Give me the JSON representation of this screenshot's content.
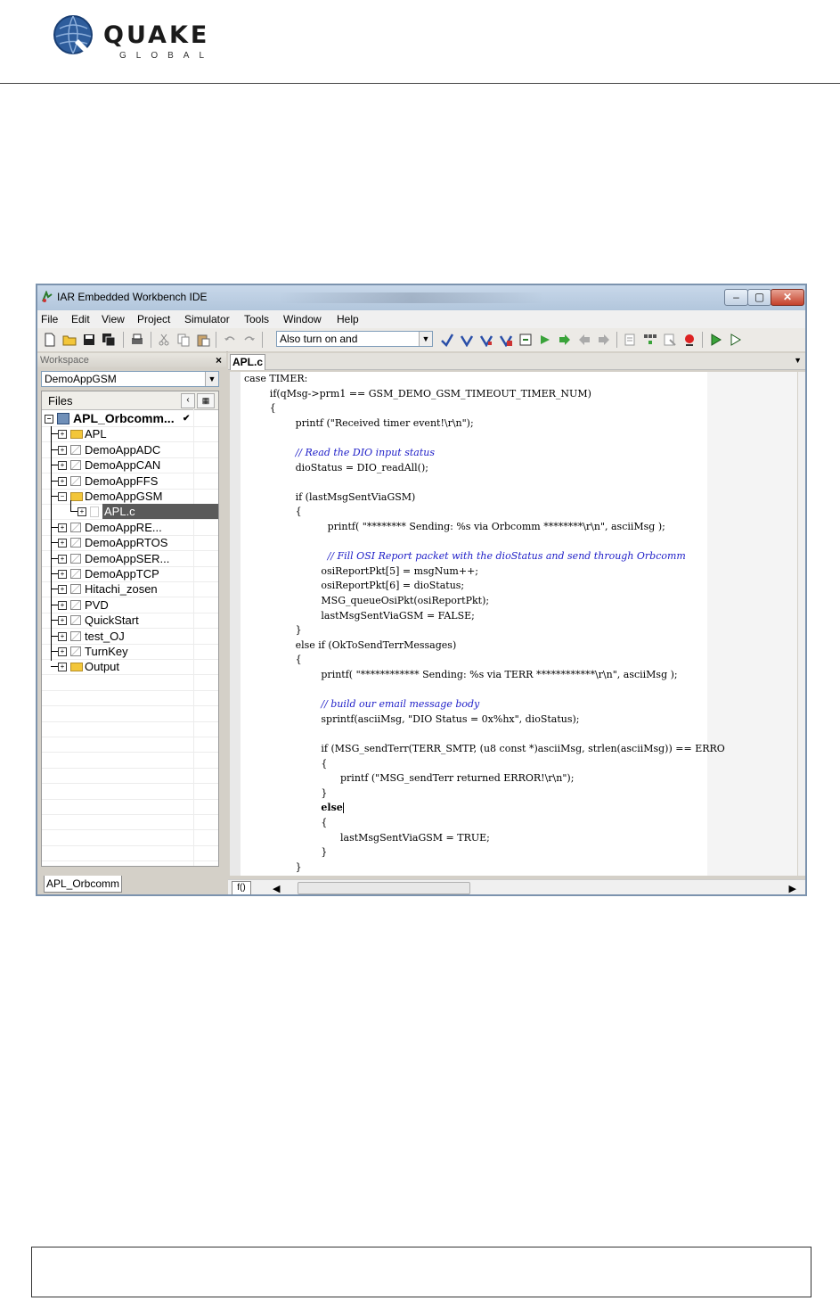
{
  "document": {
    "logo": {
      "word": "QUAKE",
      "sub": "GLOBAL"
    }
  },
  "ide": {
    "title": "IAR Embedded Workbench IDE",
    "window_buttons": {
      "minimize": "–",
      "maximize": "▢",
      "close": "✕"
    },
    "menu": [
      "File",
      "Edit",
      "View",
      "Project",
      "Simulator",
      "Tools",
      "Window",
      "Help"
    ],
    "toolbar": {
      "search_value": "Also turn on and",
      "icons": [
        "new-file-icon",
        "open-folder-icon",
        "save-icon",
        "save-all-icon",
        "print-icon",
        "cut-icon",
        "copy-icon",
        "paste-icon",
        "undo-icon",
        "redo-icon",
        "find-icon",
        "find-next-icon",
        "find-prev-icon",
        "replace-icon",
        "go-to-icon",
        "bookmark-icon",
        "next-bookmark-icon",
        "prev-bookmark-icon",
        "next-error-icon",
        "compile-icon",
        "make-icon",
        "rebuild-icon",
        "stop-build-icon",
        "breakpoint-icon",
        "debug-icon",
        "debug-no-download-icon"
      ]
    },
    "workspace": {
      "header": "Workspace",
      "close": "×",
      "config": "DemoAppGSM",
      "files_header": "Files",
      "tab": "APL_Orbcomm",
      "tree": [
        {
          "label": "APL_Orbcomm...",
          "level": 0,
          "icon": "project",
          "check": "✔"
        },
        {
          "label": "APL",
          "level": 1,
          "icon": "folder"
        },
        {
          "label": "DemoAppADC",
          "level": 1,
          "icon": "pkg"
        },
        {
          "label": "DemoAppCAN",
          "level": 1,
          "icon": "pkg"
        },
        {
          "label": "DemoAppFFS",
          "level": 1,
          "icon": "pkg"
        },
        {
          "label": "DemoAppGSM",
          "level": 1,
          "icon": "folder",
          "expanded": true
        },
        {
          "label": "APL.c",
          "level": 2,
          "icon": "file",
          "selected": true
        },
        {
          "label": "DemoAppRE...",
          "level": 1,
          "icon": "pkg"
        },
        {
          "label": "DemoAppRTOS",
          "level": 1,
          "icon": "pkg"
        },
        {
          "label": "DemoAppSER...",
          "level": 1,
          "icon": "pkg"
        },
        {
          "label": "DemoAppTCP",
          "level": 1,
          "icon": "pkg"
        },
        {
          "label": "Hitachi_zosen",
          "level": 1,
          "icon": "pkg"
        },
        {
          "label": "PVD",
          "level": 1,
          "icon": "pkg"
        },
        {
          "label": "QuickStart",
          "level": 1,
          "icon": "pkg"
        },
        {
          "label": "test_OJ",
          "level": 1,
          "icon": "pkg"
        },
        {
          "label": "TurnKey",
          "level": 1,
          "icon": "pkg"
        },
        {
          "label": "Output",
          "level": 1,
          "icon": "folder"
        }
      ]
    },
    "editor": {
      "tab": "APL.c",
      "func_button": "f()",
      "lines": [
        {
          "indent": 0,
          "text": "case TIMER:",
          "style": "code"
        },
        {
          "indent": 4,
          "text": "if(qMsg->prm1 == GSM_DEMO_GSM_TIMEOUT_TIMER_NUM)",
          "style": "code"
        },
        {
          "indent": 4,
          "text": "{",
          "style": "code"
        },
        {
          "indent": 8,
          "text": "printf (\"Received timer event!\\r\\n\");",
          "style": "code"
        },
        {
          "indent": 8,
          "text": "",
          "style": "code"
        },
        {
          "indent": 8,
          "text": "// Read the DIO input status",
          "style": "comment"
        },
        {
          "indent": 8,
          "text": "dioStatus = DIO_readAll();",
          "style": "code"
        },
        {
          "indent": 8,
          "text": "",
          "style": "code"
        },
        {
          "indent": 8,
          "text": "if (lastMsgSentViaGSM)",
          "style": "code"
        },
        {
          "indent": 8,
          "text": "{",
          "style": "code"
        },
        {
          "indent": 13,
          "text": "printf( \"******** Sending: %s via Orbcomm ********\\r\\n\", asciiMsg );",
          "style": "code"
        },
        {
          "indent": 8,
          "text": "",
          "style": "code"
        },
        {
          "indent": 13,
          "text": "// Fill OSI Report packet with the dioStatus and send through Orbcomm",
          "style": "comment"
        },
        {
          "indent": 12,
          "text": "osiReportPkt[5] = msgNum++;",
          "style": "code"
        },
        {
          "indent": 12,
          "text": "osiReportPkt[6] = dioStatus;",
          "style": "code"
        },
        {
          "indent": 12,
          "text": "MSG_queueOsiPkt(osiReportPkt);",
          "style": "code"
        },
        {
          "indent": 12,
          "text": "lastMsgSentViaGSM = FALSE;",
          "style": "code"
        },
        {
          "indent": 8,
          "text": "}",
          "style": "code"
        },
        {
          "indent": 8,
          "text": "else if (OkToSendTerrMessages)",
          "style": "code"
        },
        {
          "indent": 8,
          "text": "{",
          "style": "code"
        },
        {
          "indent": 12,
          "text": "printf( \"************ Sending: %s via TERR ************\\r\\n\", asciiMsg );",
          "style": "code"
        },
        {
          "indent": 12,
          "text": "",
          "style": "code"
        },
        {
          "indent": 12,
          "text": "// build our email message body",
          "style": "comment"
        },
        {
          "indent": 12,
          "text": "sprintf(asciiMsg, \"DIO Status = 0x%hx\", dioStatus);",
          "style": "code"
        },
        {
          "indent": 12,
          "text": "",
          "style": "code"
        },
        {
          "indent": 12,
          "text": "if (MSG_sendTerr(TERR_SMTP, (u8 const *)asciiMsg, strlen(asciiMsg)) == ERRO",
          "style": "code"
        },
        {
          "indent": 12,
          "text": "{",
          "style": "code"
        },
        {
          "indent": 15,
          "text": "printf (\"MSG_sendTerr returned ERROR!\\r\\n\");",
          "style": "code"
        },
        {
          "indent": 12,
          "text": "}",
          "style": "code"
        },
        {
          "indent": 12,
          "text": "else",
          "style": "kwcursor"
        },
        {
          "indent": 12,
          "text": "{",
          "style": "code"
        },
        {
          "indent": 15,
          "text": "lastMsgSentViaGSM = TRUE;",
          "style": "code"
        },
        {
          "indent": 12,
          "text": "}",
          "style": "code"
        },
        {
          "indent": 8,
          "text": "}",
          "style": "code"
        }
      ]
    }
  }
}
